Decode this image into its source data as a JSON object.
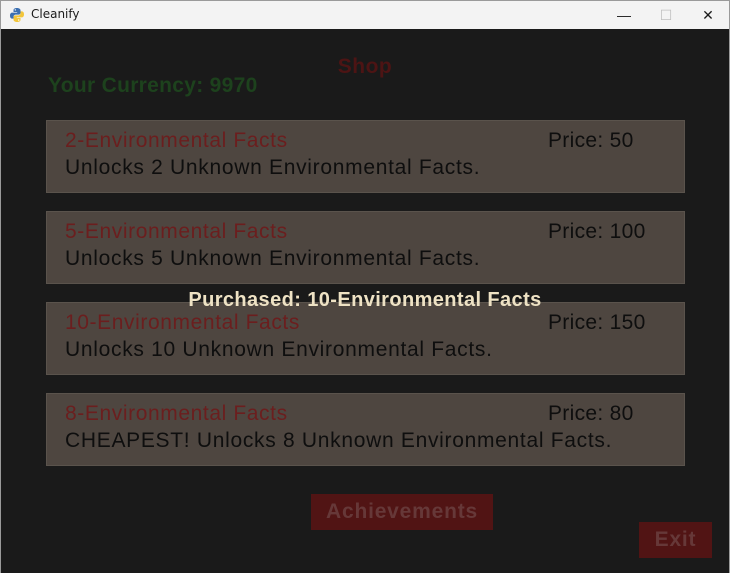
{
  "window": {
    "title": "Cleanify",
    "minimize_glyph": "—",
    "maximize_glyph": "☐",
    "close_glyph": "✕"
  },
  "shop": {
    "title": "Shop",
    "currency_text": "Your Currency: 9970",
    "items": [
      {
        "name": "2-Environmental Facts",
        "price": "Price: 50",
        "description": "Unlocks 2 Unknown Environmental Facts."
      },
      {
        "name": "5-Environmental Facts",
        "price": "Price: 100",
        "description": "Unlocks 5 Unknown Environmental Facts."
      },
      {
        "name": "10-Environmental Facts",
        "price": "Price: 150",
        "description": "Unlocks 10 Unknown Environmental Facts."
      },
      {
        "name": "8-Environmental Facts",
        "price": "Price: 80",
        "description": "CHEAPEST! Unlocks 8 Unknown Environmental Facts."
      }
    ],
    "message": "Purchased: 10-Environmental Facts",
    "achievements_label": "Achievements",
    "exit_label": "Exit"
  },
  "colors": {
    "background": "#1a1a1a",
    "card": "#4e4640",
    "title_red": "#4d1414",
    "currency_green": "#1d421d",
    "button": "#511414",
    "message": "#eee2c4"
  }
}
